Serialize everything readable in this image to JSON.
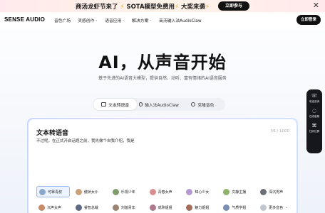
{
  "promo": {
    "text": "商汤龙虾节来了",
    "text2": "SOTA模型免费用",
    "text3": "大奖来袭",
    "cta": "立即参与"
  },
  "nav": {
    "logo": "SENSE AUDIO",
    "items": [
      {
        "label": "音色广场",
        "dropdown": false
      },
      {
        "label": "灵感创作",
        "dropdown": true
      },
      {
        "label": "语音应用",
        "dropdown": true
      },
      {
        "label": "解决方案",
        "dropdown": true
      },
      {
        "label": "商汤输入法AudioClaw",
        "dropdown": false
      }
    ],
    "login": "立即登录"
  },
  "hero": {
    "title": "AI，从声音开始",
    "subtitle": "基于先进的AI语音大模型，提供自然、动听、富有情绪的AI语音服务"
  },
  "tabs": [
    {
      "label": "文本转语音",
      "active": true
    },
    {
      "label": "输入法AudioClaw",
      "active": false
    },
    {
      "label": "克隆音色",
      "active": false
    }
  ],
  "card": {
    "title": "文本转语音",
    "count": "56 / 1000",
    "text": "不过呢，在正式开启话题之前，我先做个自我介绍，我是"
  },
  "voices": [
    {
      "label": "可靠青叔",
      "color": "#8aa6c8",
      "selected": true
    },
    {
      "label": "傲娇女仆",
      "color": "#c9a27a",
      "selected": false
    },
    {
      "label": "乐观少年",
      "color": "#7f9c6b",
      "selected": false
    },
    {
      "label": "青春女声",
      "color": "#d98f8f",
      "selected": false
    },
    {
      "label": "知心少女",
      "color": "#b59ad1",
      "selected": false
    },
    {
      "label": "文静主播",
      "color": "#8fb36a",
      "selected": false
    },
    {
      "label": "深沉男声",
      "color": "#6a6f7a",
      "selected": false
    },
    {
      "label": "沉声女声",
      "color": "#c98a6a",
      "selected": false
    },
    {
      "label": "睿智总裁",
      "color": "#5e6b82",
      "selected": false
    },
    {
      "label": "刘莲青年",
      "color": "#9a8471",
      "selected": false
    },
    {
      "label": "成熟姐姐",
      "color": "#b07a8e",
      "selected": false
    },
    {
      "label": "魅力姐姐",
      "color": "#a86c5a",
      "selected": false
    },
    {
      "label": "气质学姐",
      "color": "#7a8fb3",
      "selected": false
    },
    {
      "label": "更多音色",
      "color": "#c2c6cf",
      "selected": false
    }
  ],
  "sidetool": [
    {
      "label": "电话咨询",
      "icon": "phone-icon"
    },
    {
      "label": "在线客服",
      "icon": "chat-icon"
    },
    {
      "label": "扫码社群",
      "icon": "qr-icon"
    }
  ]
}
